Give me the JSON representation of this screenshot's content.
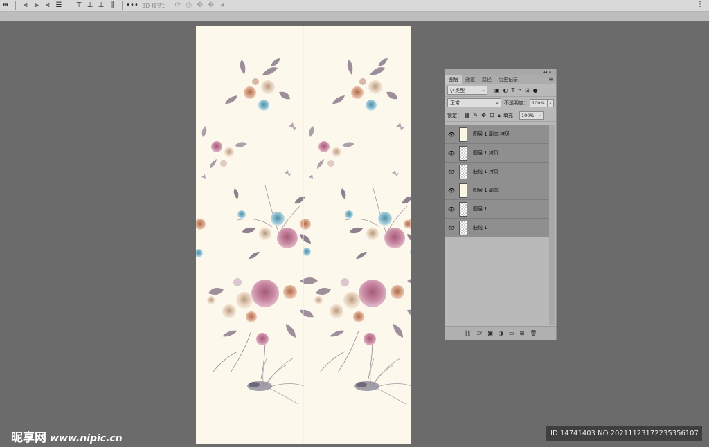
{
  "toolbar": {
    "mode_3d_label": "3D 模式：",
    "right_icon": "⋮",
    "icons": [
      "move-tool-icon",
      "align-left-icon",
      "align-center-icon",
      "align-right-icon",
      "distribute-icon",
      "align-top-icon",
      "align-middle-icon",
      "align-bottom-icon",
      "distribute-vertical-icon",
      "more-icon",
      "3d-orbit-icon",
      "3d-roll-icon",
      "3d-drag-icon",
      "3d-slide-icon",
      "3d-scale-icon"
    ]
  },
  "layers_panel": {
    "tabs": [
      "图层",
      "通道",
      "路径",
      "历史记录"
    ],
    "active_tab": "图层",
    "filter": {
      "label": "类型"
    },
    "blend_mode": "正常",
    "opacity_label": "不透明度：",
    "opacity_value": "100%",
    "lock_label": "锁定：",
    "fill_label": "填充：",
    "fill_value": "100%",
    "layers": [
      {
        "name": "图层 1 副本 拷贝",
        "thumb": "cream"
      },
      {
        "name": "图层 1 拷贝",
        "thumb": "transparent"
      },
      {
        "name": "曲线 1 拷贝",
        "thumb": "transparent"
      },
      {
        "name": "图层 1 副本",
        "thumb": "cream"
      },
      {
        "name": "图层 1",
        "thumb": "transparent"
      },
      {
        "name": "曲线 1",
        "thumb": "transparent"
      }
    ],
    "footer_icons": [
      "link-icon",
      "fx-icon",
      "mask-icon",
      "adjustment-icon",
      "folder-icon",
      "new-layer-icon",
      "trash-icon"
    ]
  },
  "watermark": {
    "brand": "昵享网",
    "url": "www.nipic.cn",
    "id_text": "ID:14741403 NO:20211123172235356107"
  }
}
